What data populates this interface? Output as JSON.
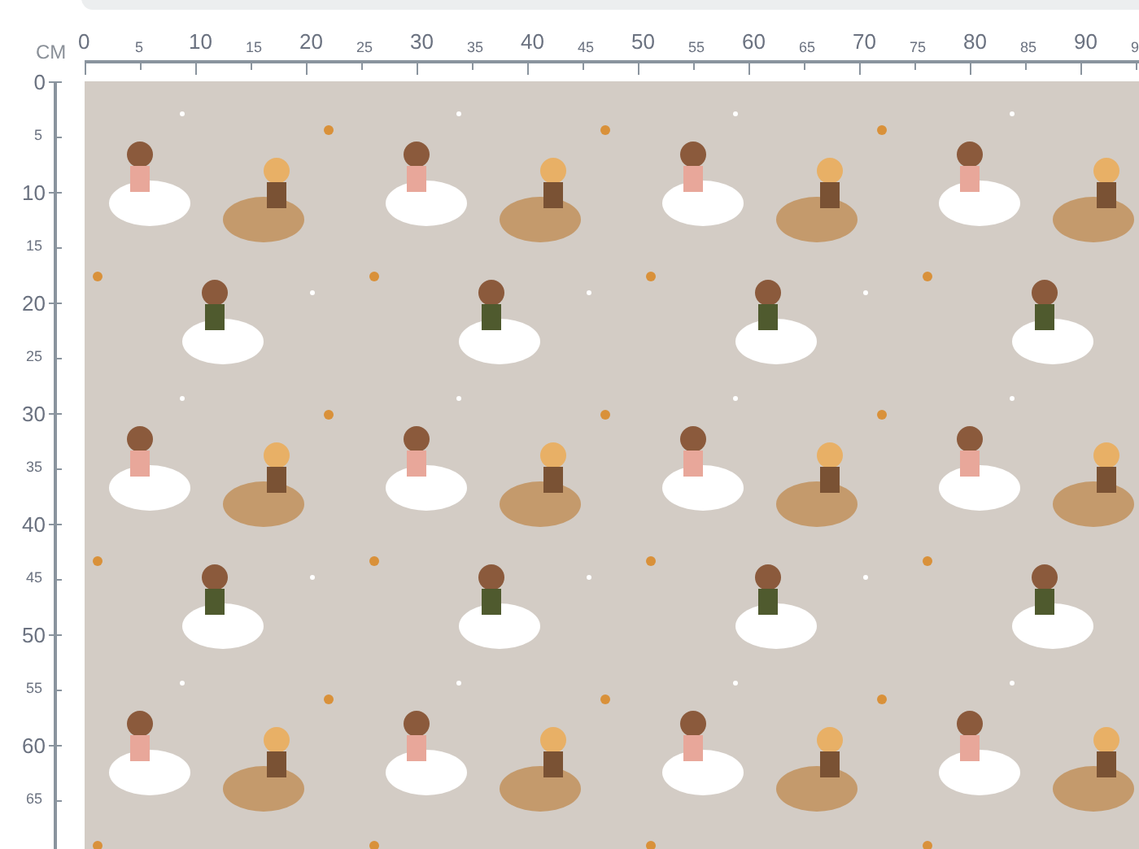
{
  "unit": "CM",
  "top_ruler": [
    {
      "label": "0",
      "kind": "major"
    },
    {
      "label": "5",
      "kind": "minor"
    },
    {
      "label": "10",
      "kind": "major"
    },
    {
      "label": "15",
      "kind": "minor"
    },
    {
      "label": "20",
      "kind": "major"
    },
    {
      "label": "25",
      "kind": "minor"
    },
    {
      "label": "30",
      "kind": "major"
    },
    {
      "label": "35",
      "kind": "minor"
    },
    {
      "label": "40",
      "kind": "major"
    },
    {
      "label": "45",
      "kind": "minor"
    },
    {
      "label": "50",
      "kind": "major"
    },
    {
      "label": "55",
      "kind": "minor"
    },
    {
      "label": "60",
      "kind": "major"
    },
    {
      "label": "65",
      "kind": "minor"
    },
    {
      "label": "70",
      "kind": "major"
    },
    {
      "label": "75",
      "kind": "minor"
    },
    {
      "label": "80",
      "kind": "major"
    },
    {
      "label": "85",
      "kind": "minor"
    },
    {
      "label": "90",
      "kind": "major"
    },
    {
      "label": "9",
      "kind": "minor"
    }
  ],
  "left_ruler": [
    {
      "label": "0",
      "kind": "major"
    },
    {
      "label": "5",
      "kind": "minor"
    },
    {
      "label": "10",
      "kind": "major"
    },
    {
      "label": "15",
      "kind": "minor"
    },
    {
      "label": "20",
      "kind": "major"
    },
    {
      "label": "25",
      "kind": "minor"
    },
    {
      "label": "30",
      "kind": "major"
    },
    {
      "label": "35",
      "kind": "minor"
    },
    {
      "label": "40",
      "kind": "major"
    },
    {
      "label": "45",
      "kind": "minor"
    },
    {
      "label": "50",
      "kind": "major"
    },
    {
      "label": "55",
      "kind": "minor"
    },
    {
      "label": "60",
      "kind": "major"
    },
    {
      "label": "65",
      "kind": "minor"
    }
  ]
}
